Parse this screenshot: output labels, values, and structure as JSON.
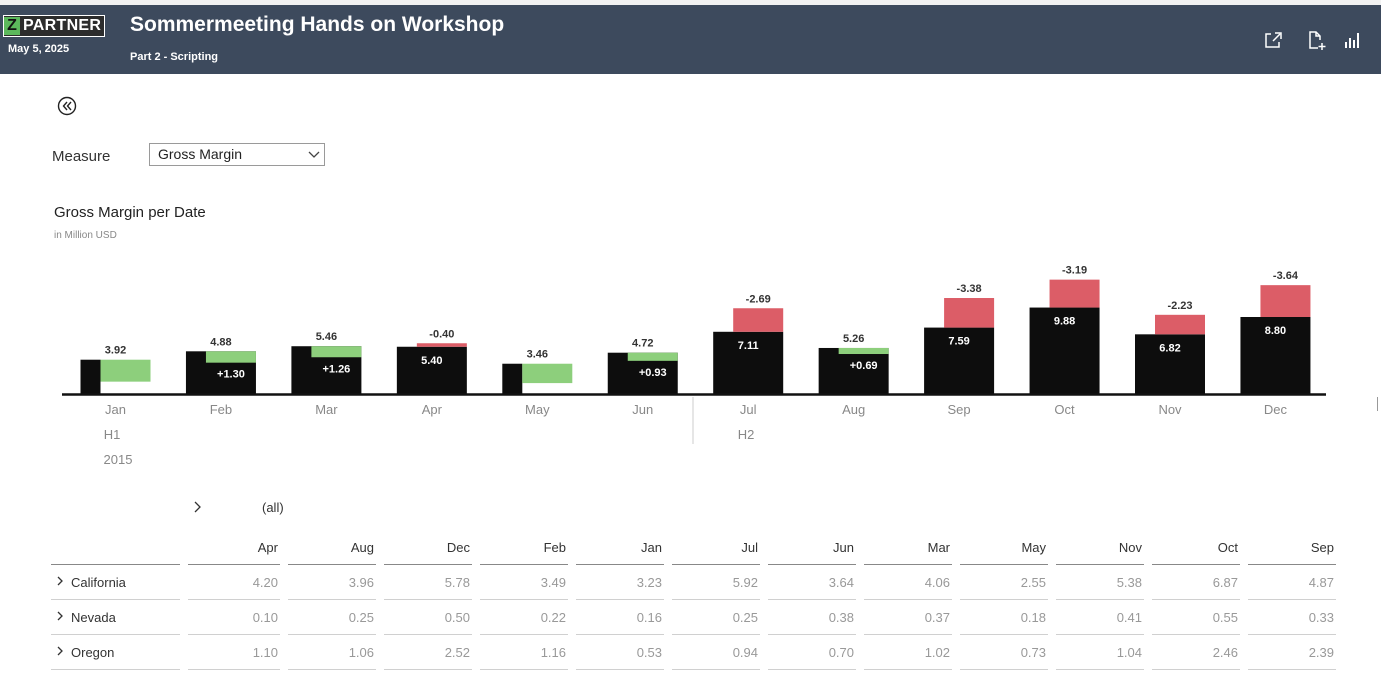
{
  "header": {
    "logo_letter": "Z",
    "logo_text": "PARTNER",
    "date": "May 5, 2025",
    "title": "Sommermeeting Hands on Workshop",
    "subtitle": "Part 2 - Scripting",
    "icons": [
      "share-icon",
      "add-page-icon",
      "chart-icon"
    ]
  },
  "controls": {
    "back_icon": "double-chevron-left-icon",
    "measure_label": "Measure",
    "measure_value": "Gross Margin"
  },
  "chart_data": {
    "type": "bar",
    "title": "Gross Margin per Date",
    "subtitle": "in Million USD",
    "categories": [
      "Jan",
      "Feb",
      "Mar",
      "Apr",
      "May",
      "Jun",
      "Jul",
      "Aug",
      "Sep",
      "Oct",
      "Nov",
      "Dec"
    ],
    "series": [
      {
        "values": [
          3.92,
          4.88,
          5.46,
          5.4,
          3.46,
          4.72,
          7.11,
          5.26,
          7.59,
          9.88,
          6.82,
          8.8
        ]
      }
    ],
    "variance": {
      "labels": [
        "",
        "+1.30",
        "+1.26",
        "-0.40",
        "",
        "+0.93",
        "-2.69",
        "+0.69",
        "-3.38",
        "-3.19",
        "-2.23",
        "-3.64"
      ],
      "values": [
        null,
        1.3,
        1.26,
        -0.4,
        null,
        0.93,
        -2.69,
        0.69,
        -3.38,
        -3.19,
        -2.23,
        -3.64
      ]
    },
    "groups": [
      {
        "label": "H1",
        "year": "2015"
      },
      {
        "label": "H2",
        "year": ""
      }
    ],
    "colors": {
      "base": "#0d0d0d",
      "positive": "#8dcf7c",
      "negative": "#dc5d67"
    },
    "grid": false
  },
  "table": {
    "expander_label": "(all)",
    "columns": [
      "Apr",
      "Aug",
      "Dec",
      "Feb",
      "Jan",
      "Jul",
      "Jun",
      "Mar",
      "May",
      "Nov",
      "Oct",
      "Sep"
    ],
    "rows": [
      {
        "label": "California",
        "values": [
          "4.20",
          "3.96",
          "5.78",
          "3.49",
          "3.23",
          "5.92",
          "3.64",
          "4.06",
          "2.55",
          "5.38",
          "6.87",
          "4.87"
        ]
      },
      {
        "label": "Nevada",
        "values": [
          "0.10",
          "0.25",
          "0.50",
          "0.22",
          "0.16",
          "0.25",
          "0.38",
          "0.37",
          "0.18",
          "0.41",
          "0.55",
          "0.33"
        ]
      },
      {
        "label": "Oregon",
        "values": [
          "1.10",
          "1.06",
          "2.52",
          "1.16",
          "0.53",
          "0.94",
          "0.70",
          "1.02",
          "0.73",
          "1.04",
          "2.46",
          "2.39"
        ]
      }
    ]
  }
}
